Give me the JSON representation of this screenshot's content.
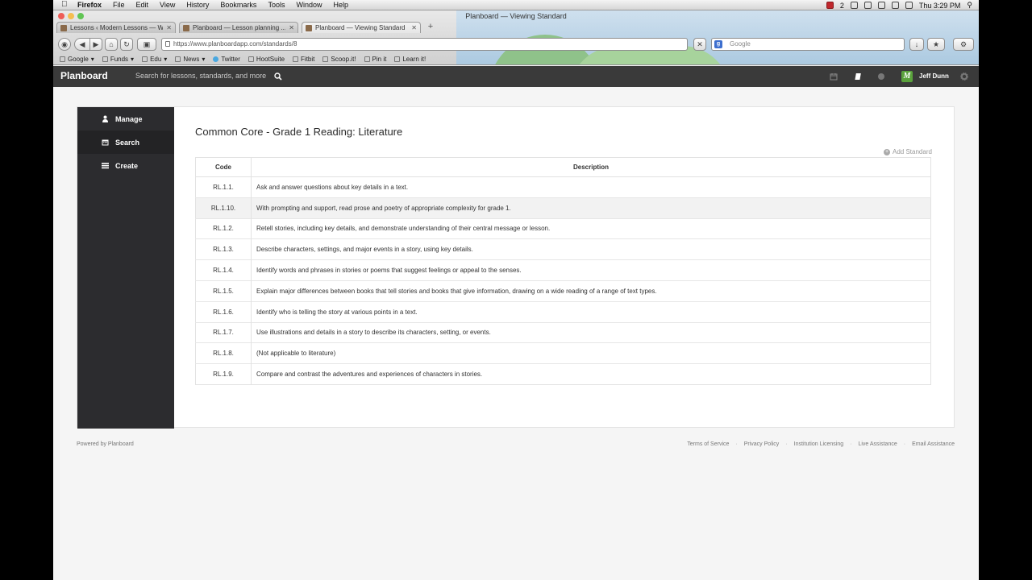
{
  "menubar": {
    "app": "Firefox",
    "items": [
      "File",
      "Edit",
      "View",
      "History",
      "Bookmarks",
      "Tools",
      "Window",
      "Help"
    ],
    "tray_count": "2",
    "clock": "Thu 3:29 PM"
  },
  "browser": {
    "window_title": "Planboard — Viewing Standard",
    "tabs": [
      {
        "label": "Lessons ‹ Modern Lessons — W..."
      },
      {
        "label": "Planboard — Lesson planning ..."
      },
      {
        "label": "Planboard — Viewing Standard"
      }
    ],
    "url": "https://www.planboardapp.com/standards/8",
    "search_placeholder": "Google",
    "bookmarks": [
      "Google",
      "Funds",
      "Edu",
      "News",
      "Twitter",
      "HootSuite",
      "Fitbit",
      "Scoop.it!",
      "Pin it",
      "Learn it!"
    ]
  },
  "topnav": {
    "brand": "Planboard",
    "search_placeholder": "Search for lessons, standards, and more",
    "user_initial": "M",
    "user_name": "Jeff Dunn"
  },
  "sidebar": {
    "items": [
      {
        "label": "Manage"
      },
      {
        "label": "Search"
      },
      {
        "label": "Create"
      }
    ]
  },
  "main": {
    "title": "Common Core - Grade 1 Reading: Literature",
    "add_standard": "Add Standard",
    "columns": [
      "Code",
      "Description"
    ],
    "rows": [
      {
        "code": "RL.1.1.",
        "description": "Ask and answer questions about key details in a text."
      },
      {
        "code": "RL.1.10.",
        "description": "With prompting and support, read prose and poetry of appropriate complexity for grade 1."
      },
      {
        "code": "RL.1.2.",
        "description": "Retell stories, including key details, and demonstrate understanding of their central message or lesson."
      },
      {
        "code": "RL.1.3.",
        "description": "Describe characters, settings, and major events in a story, using key details."
      },
      {
        "code": "RL.1.4.",
        "description": "Identify words and phrases in stories or poems that suggest feelings or appeal to the senses."
      },
      {
        "code": "RL.1.5.",
        "description": "Explain major differences between books that tell stories and books that give information, drawing on a wide reading of a range of text types."
      },
      {
        "code": "RL.1.6.",
        "description": "Identify who is telling the story at various points in a text."
      },
      {
        "code": "RL.1.7.",
        "description": "Use illustrations and details in a story to describe its characters, setting, or events."
      },
      {
        "code": "RL.1.8.",
        "description": "(Not applicable to literature)"
      },
      {
        "code": "RL.1.9.",
        "description": "Compare and contrast the adventures and experiences of characters in stories."
      }
    ]
  },
  "footer": {
    "powered": "Powered by Planboard",
    "links": [
      "Terms of Service",
      "Privacy Policy",
      "Institution Licensing",
      "Live Assistance",
      "Email Assistance"
    ]
  }
}
